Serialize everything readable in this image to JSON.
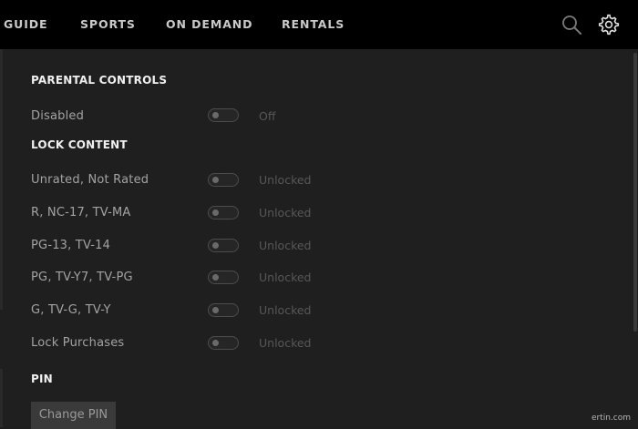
{
  "nav": {
    "items": [
      {
        "label": "GUIDE"
      },
      {
        "label": "SPORTS"
      },
      {
        "label": "ON DEMAND"
      },
      {
        "label": "RENTALS"
      }
    ],
    "icons": [
      "search-icon",
      "gear-icon"
    ]
  },
  "parental_controls": {
    "title": "PARENTAL CONTROLS",
    "label": "Disabled",
    "state": "Off",
    "enabled": false
  },
  "lock_content": {
    "title": "LOCK CONTENT",
    "rows": [
      {
        "label": "Unrated, Not Rated",
        "state": "Unlocked"
      },
      {
        "label": "R, NC-17, TV-MA",
        "state": "Unlocked"
      },
      {
        "label": "PG-13, TV-14",
        "state": "Unlocked"
      },
      {
        "label": "PG, TV-Y7, TV-PG",
        "state": "Unlocked"
      },
      {
        "label": "G, TV-G, TV-Y",
        "state": "Unlocked"
      },
      {
        "label": "Lock Purchases",
        "state": "Unlocked"
      }
    ]
  },
  "pin": {
    "title": "PIN",
    "button_label": "Change PIN"
  },
  "watermark": "ertin.com",
  "colors": {
    "topbar": "#000000",
    "background": "#1f1f1f",
    "section_title": "#f0f0f0",
    "label": "#a3a3a3",
    "state_text": "#575757"
  }
}
